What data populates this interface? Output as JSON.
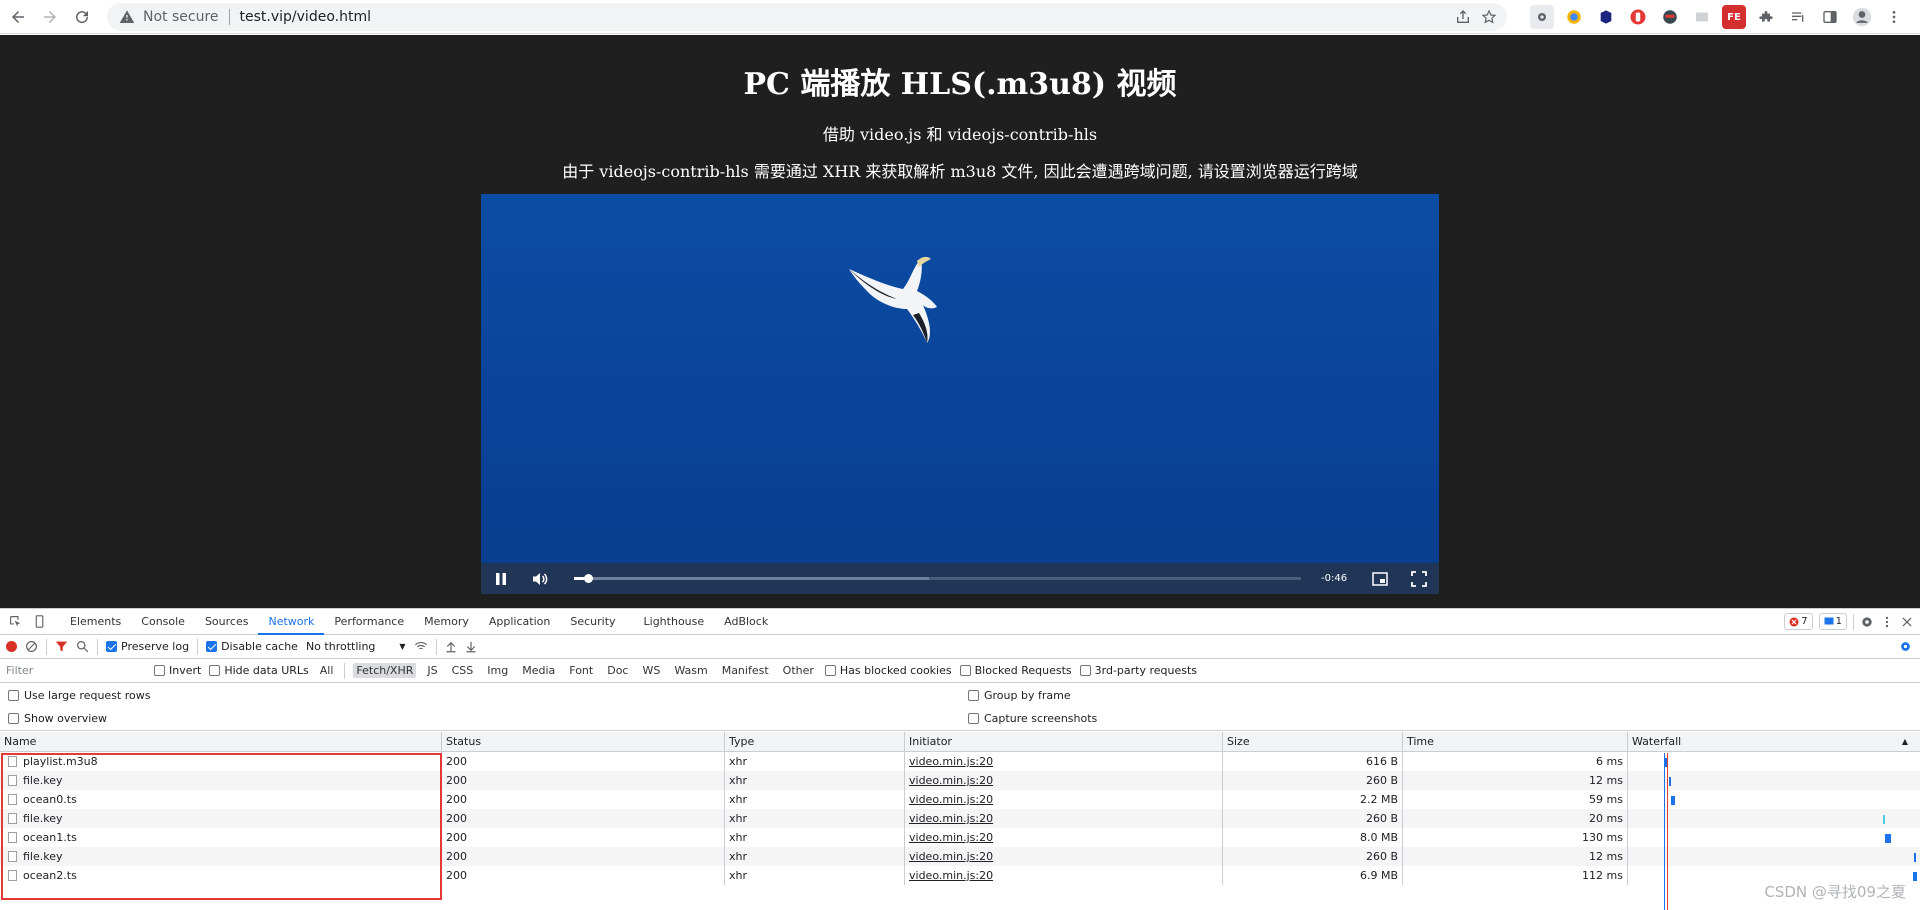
{
  "browser": {
    "security_label": "Not secure",
    "url": "test.vip/video.html",
    "extensions": [
      {
        "name": "ext-gear",
        "label": "",
        "color": "#5f6368"
      },
      {
        "name": "ext-bird",
        "label": "",
        "color": "#f4b400"
      },
      {
        "name": "ext-shield",
        "label": "",
        "color": "#1a237e"
      },
      {
        "name": "ext-adblock",
        "label": "",
        "color": "#e53935"
      },
      {
        "name": "ext-face",
        "label": "",
        "color": "#37474f"
      },
      {
        "name": "ext-grey",
        "label": "",
        "color": "#9e9e9e"
      },
      {
        "name": "ext-fe",
        "label": "FE",
        "color": "#d32f2f"
      }
    ]
  },
  "page": {
    "title": "PC 端播放 HLS(.m3u8) 视频",
    "subtitle": "借助 video.js 和 videojs-contrib-hls",
    "note": "由于 videojs-contrib-hls 需要通过 XHR 来获取解析 m3u8 文件, 因此会遭遇跨域问题, 请设置浏览器运行跨域"
  },
  "player": {
    "time_remaining": "-0:46",
    "played_fraction": 0.02,
    "buffered_fraction": 0.48
  },
  "devtools": {
    "tabs": [
      "Elements",
      "Console",
      "Sources",
      "Network",
      "Performance",
      "Memory",
      "Application",
      "Security",
      "Lighthouse",
      "AdBlock"
    ],
    "active_tab": "Network",
    "error_count": "7",
    "message_count": "1",
    "toolbar": {
      "preserve_log": "Preserve log",
      "disable_cache": "Disable cache",
      "throttling": "No throttling"
    },
    "filter": {
      "placeholder": "Filter",
      "invert": "Invert",
      "hide_data_urls": "Hide data URLs",
      "types": [
        "All",
        "Fetch/XHR",
        "JS",
        "CSS",
        "Img",
        "Media",
        "Font",
        "Doc",
        "WS",
        "Wasm",
        "Manifest",
        "Other"
      ],
      "active_type": "Fetch/XHR",
      "has_blocked_cookies": "Has blocked cookies",
      "blocked_requests": "Blocked Requests",
      "third_party": "3rd-party requests"
    },
    "options": {
      "large_rows": "Use large request rows",
      "show_overview": "Show overview",
      "group_by_frame": "Group by frame",
      "capture_screenshots": "Capture screenshots"
    },
    "columns": [
      "Name",
      "Status",
      "Type",
      "Initiator",
      "Size",
      "Time",
      "Waterfall"
    ],
    "requests": [
      {
        "name": "playlist.m3u8",
        "status": "200",
        "type": "xhr",
        "initiator": "video.min.js:20",
        "size": "616 B",
        "time": "6 ms"
      },
      {
        "name": "file.key",
        "status": "200",
        "type": "xhr",
        "initiator": "video.min.js:20",
        "size": "260 B",
        "time": "12 ms"
      },
      {
        "name": "ocean0.ts",
        "status": "200",
        "type": "xhr",
        "initiator": "video.min.js:20",
        "size": "2.2 MB",
        "time": "59 ms"
      },
      {
        "name": "file.key",
        "status": "200",
        "type": "xhr",
        "initiator": "video.min.js:20",
        "size": "260 B",
        "time": "20 ms"
      },
      {
        "name": "ocean1.ts",
        "status": "200",
        "type": "xhr",
        "initiator": "video.min.js:20",
        "size": "8.0 MB",
        "time": "130 ms"
      },
      {
        "name": "file.key",
        "status": "200",
        "type": "xhr",
        "initiator": "video.min.js:20",
        "size": "260 B",
        "time": "12 ms"
      },
      {
        "name": "ocean2.ts",
        "status": "200",
        "type": "xhr",
        "initiator": "video.min.js:20",
        "size": "6.9 MB",
        "time": "112 ms"
      }
    ]
  },
  "watermark": "CSDN @寻找09之夏",
  "colors": {
    "page_bg": "#1f1f1f",
    "video_blue": "#0b4da3",
    "highlight_red": "#e53935",
    "devtools_accent": "#1a73e8"
  }
}
